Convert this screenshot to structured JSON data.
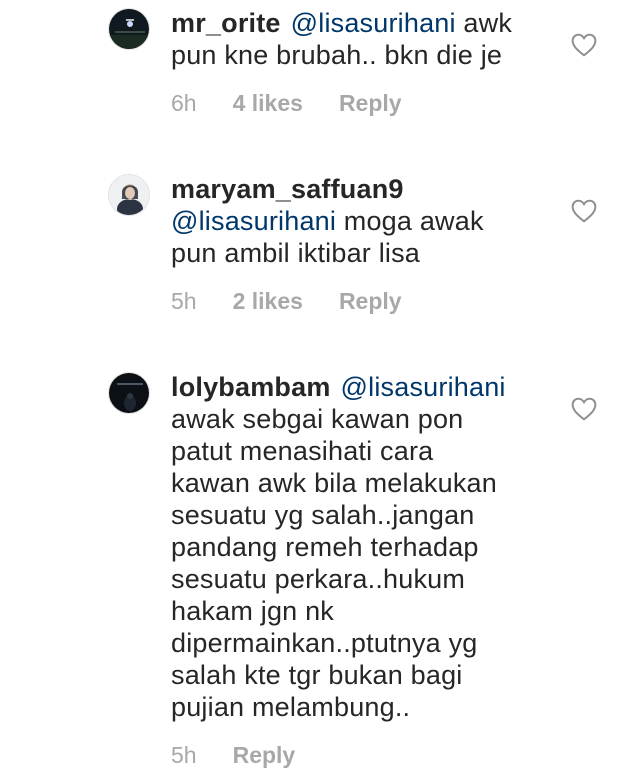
{
  "comments": [
    {
      "username": "mr_orite",
      "mention": "@lisasurihani",
      "text_after_mention": " awk\npun kne brubah.. bkn die je",
      "time": "6h",
      "likes": "4 likes",
      "reply_label": "Reply",
      "avatar_icon": "night-street-photo"
    },
    {
      "username": "maryam_saffuan9",
      "mention": "@lisasurihani",
      "text_after_mention": " moga awak\npun ambil iktibar lisa",
      "time": "5h",
      "likes": "2 likes",
      "reply_label": "Reply",
      "avatar_icon": "hijab-portrait-photo"
    },
    {
      "username": "lolybambam",
      "mention": "@lisasurihani",
      "text_after_mention": "\nawak sebgai kawan pon\npatut menasihati cara\nkawan awk bila melakukan\nsesuatu yg salah..jangan\npandang remeh terhadap\nsesuatu perkara..hukum\nhakam jgn nk\ndipermainkan..ptutnya yg\nsalah kte tgr bukan bagi\npujian melambung..",
      "time": "5h",
      "likes": "",
      "reply_label": "Reply",
      "avatar_icon": "dark-night-photo"
    }
  ],
  "colors": {
    "text": "#262626",
    "mention": "#00376b",
    "meta": "#a8a8a8",
    "heart_outline": "#8e8e8e"
  },
  "icons": {
    "like": "heart-outline-icon"
  }
}
